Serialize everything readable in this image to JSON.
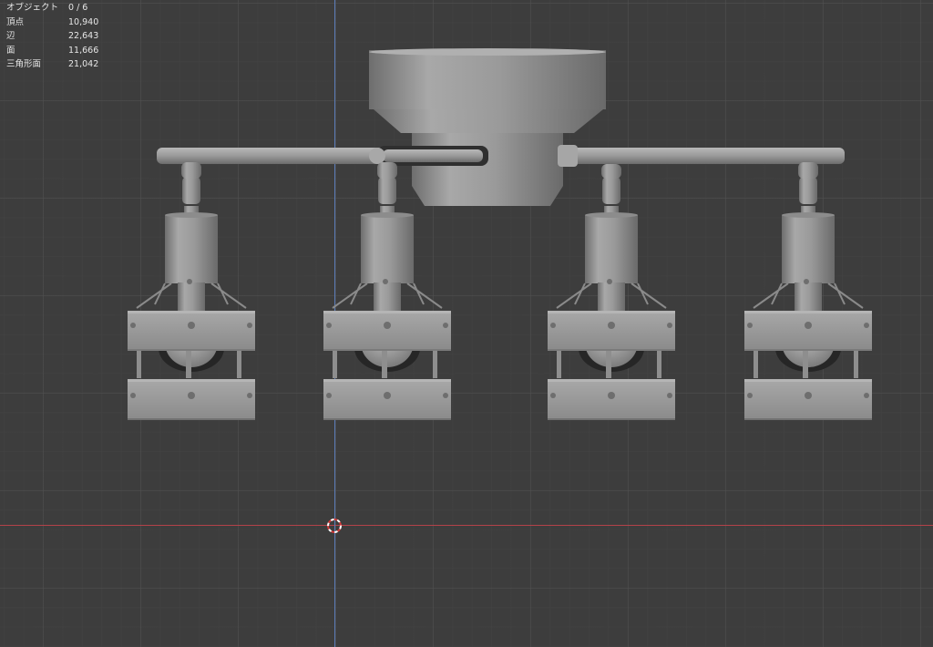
{
  "stats": {
    "rows": [
      {
        "label": "オブジェクト",
        "value": "0 / 6"
      },
      {
        "label": "頂点",
        "value": "10,940"
      },
      {
        "label": "辺",
        "value": "22,643"
      },
      {
        "label": "面",
        "value": "11,666"
      },
      {
        "label": "三角形面",
        "value": "21,042"
      }
    ]
  },
  "colors": {
    "background": "#3d3d3d",
    "x_axis": "#b4424a",
    "y_axis": "#5a7cb8",
    "mesh": "#9c9c9c"
  },
  "icons": {
    "cursor": "3d-cursor-icon"
  }
}
